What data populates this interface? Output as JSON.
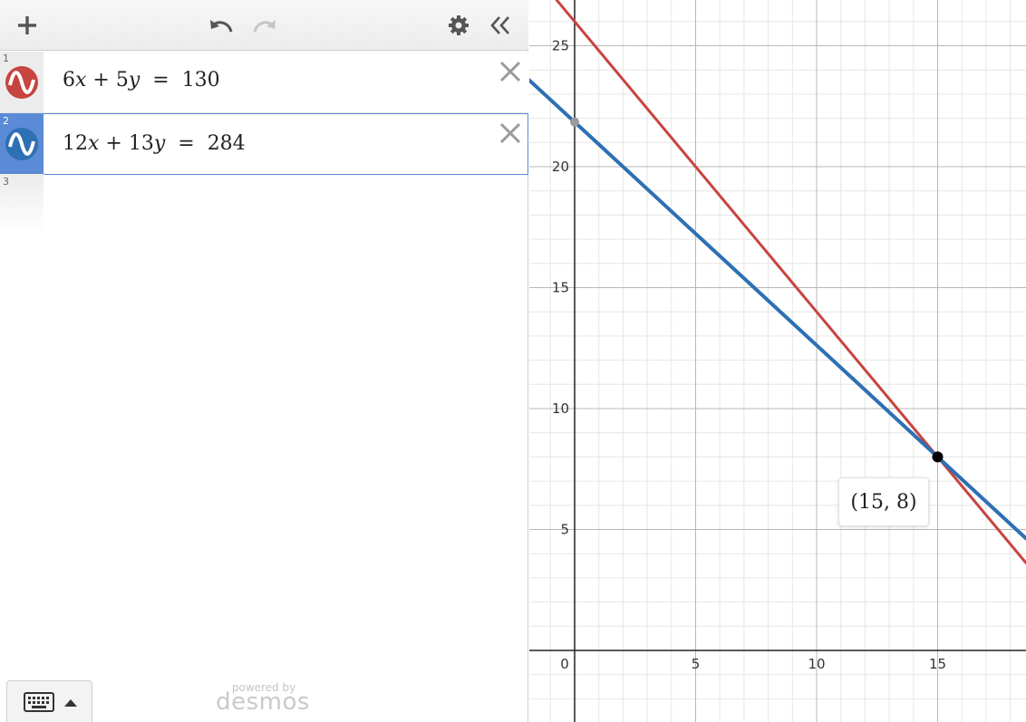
{
  "toolbar": {
    "add_icon": "plus-icon",
    "undo_icon": "undo-icon",
    "redo_icon": "redo-icon",
    "settings_icon": "gear-icon",
    "collapse_icon": "double-chevron-left-icon"
  },
  "expressions": [
    {
      "number": "1",
      "color": "#c74440",
      "lhs_a": "6",
      "var_a": "x",
      "op": " + ",
      "lhs_b": "5",
      "var_b": "y",
      "eq": "  =  ",
      "rhs": "130",
      "active": false
    },
    {
      "number": "2",
      "color": "#2d70b3",
      "lhs_a": "12",
      "var_a": "x",
      "op": " + ",
      "lhs_b": "13",
      "var_b": "y",
      "eq": "  =  ",
      "rhs": "284",
      "active": true
    },
    {
      "number": "3"
    }
  ],
  "footer": {
    "powered_by": "powered by",
    "brand": "desmos"
  },
  "graph": {
    "x_ticks": [
      "0",
      "5",
      "10",
      "15"
    ],
    "y_ticks": [
      "5",
      "10",
      "15",
      "20",
      "25"
    ],
    "intersection_label": "(15, 8)",
    "intersection": {
      "x": 15,
      "y": 8
    },
    "y_intercept_point": {
      "x": 0,
      "y": 21.846
    },
    "colors": {
      "red": "#c74440",
      "blue": "#2d70b3"
    }
  }
}
